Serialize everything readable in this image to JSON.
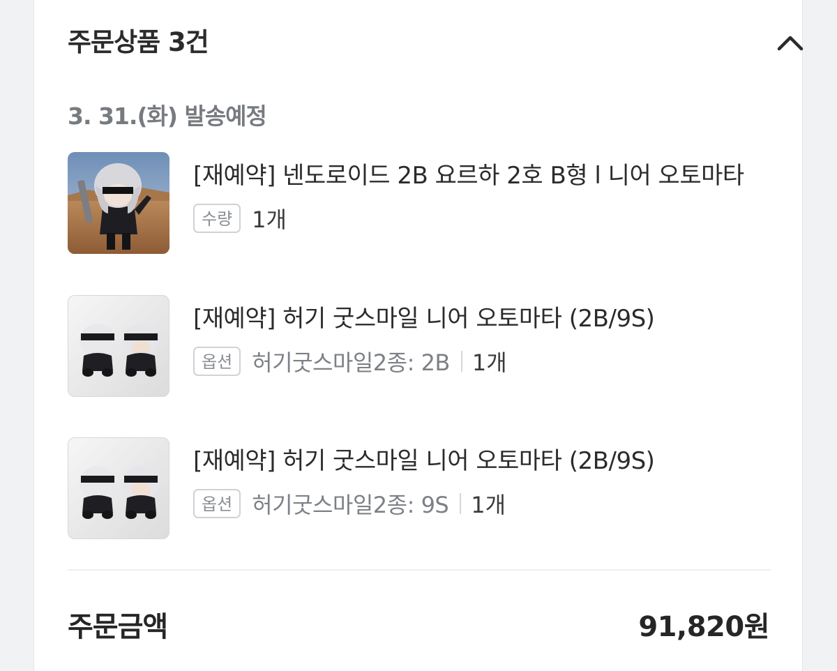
{
  "header": {
    "title": "주문상품 3건",
    "collapse_icon": "chevron-up-icon"
  },
  "shipping": {
    "date_label": "3. 31.(화) 발송예정"
  },
  "items": [
    {
      "name": "[재예약] 넨도로이드 2B 요르하 2호 B형 l 니어 오토마타",
      "tag": "수량",
      "option": "",
      "quantity": "1개",
      "thumbnail": "nendoroid-2b-figure-image"
    },
    {
      "name": "[재예약] 허기 굿스마일 니어 오토마타 (2B/9S)",
      "tag": "옵션",
      "option": "허기굿스마일2종: 2B",
      "quantity": "1개",
      "thumbnail": "hugsy-2b-9s-image"
    },
    {
      "name": "[재예약] 허기 굿스마일 니어 오토마타 (2B/9S)",
      "tag": "옵션",
      "option": "허기굿스마일2종: 9S",
      "quantity": "1개",
      "thumbnail": "hugsy-2b-9s-image"
    }
  ],
  "summary": {
    "total_label": "주문금액",
    "total_value": "91,820원"
  },
  "colors": {
    "background": "#f1f2f4",
    "card": "#ffffff",
    "muted_text": "#777b80",
    "tag_border": "#cfd2d6"
  }
}
